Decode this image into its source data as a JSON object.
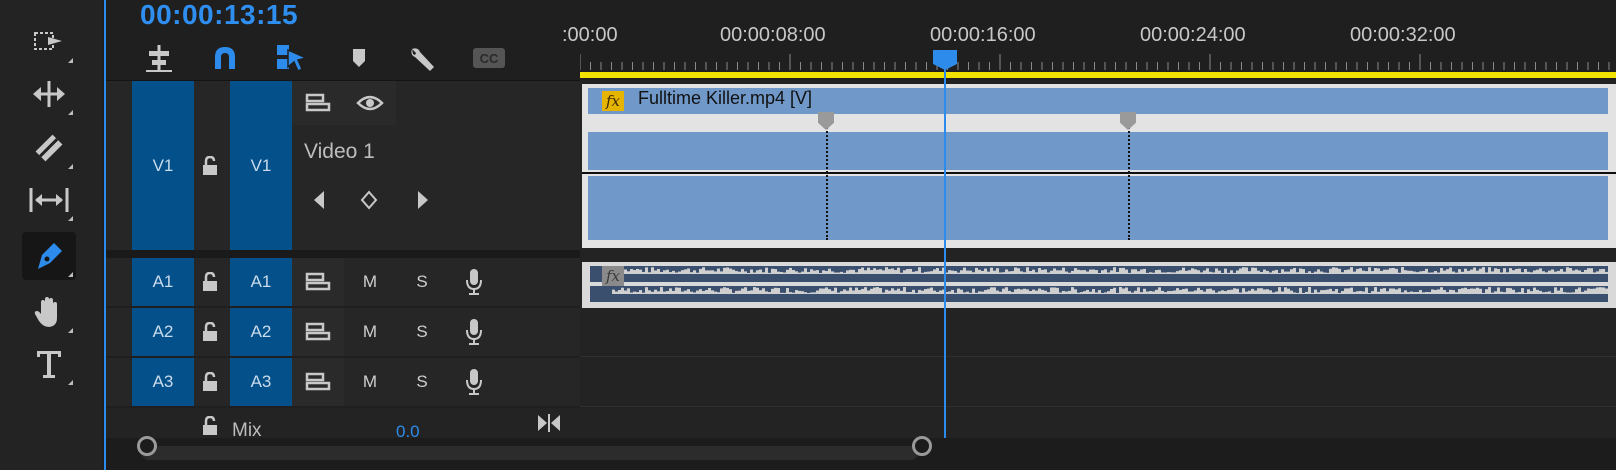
{
  "timeline": {
    "current_timecode": "00:00:13:15",
    "ruler_labels": [
      ":00:00",
      "00:00:08:00",
      "00:00:16:00",
      "00:00:24:00",
      "00:00:32:00"
    ]
  },
  "tools": [
    {
      "name": "track-select-forward-tool",
      "icon": "track-select-icon"
    },
    {
      "name": "ripple-edit-tool",
      "icon": "ripple-edit-icon"
    },
    {
      "name": "razor-tool",
      "icon": "razor-icon"
    },
    {
      "name": "slip-tool",
      "icon": "slip-icon"
    },
    {
      "name": "pen-tool",
      "icon": "pen-icon",
      "active": true
    },
    {
      "name": "hand-tool",
      "icon": "hand-icon"
    },
    {
      "name": "type-tool",
      "icon": "type-icon"
    }
  ],
  "header_buttons": [
    {
      "name": "insert-sequence-nest-button",
      "icon": "nest-icon"
    },
    {
      "name": "snap-button",
      "icon": "magnet-icon",
      "active": true
    },
    {
      "name": "linked-selection-button",
      "icon": "linked-selection-icon",
      "active": true
    },
    {
      "name": "add-marker-button",
      "icon": "marker-icon"
    },
    {
      "name": "timeline-settings-button",
      "icon": "wrench-icon"
    },
    {
      "name": "captions-button",
      "icon": "cc-icon"
    }
  ],
  "tracks": {
    "video": [
      {
        "source": "V1",
        "target": "V1",
        "name": "Video 1"
      }
    ],
    "audio": [
      {
        "source": "A1",
        "target": "A1",
        "mute": "M",
        "solo": "S"
      },
      {
        "source": "A2",
        "target": "A2",
        "mute": "M",
        "solo": "S"
      },
      {
        "source": "A3",
        "target": "A3",
        "mute": "M",
        "solo": "S"
      }
    ],
    "mix": {
      "label": "Mix",
      "value": "0.0"
    }
  },
  "clips": {
    "video_clip_name": "Fulltime Killer.mp4 [V]",
    "fx_label": "fx"
  },
  "colors": {
    "accent": "#2d8ceb",
    "track_target": "#03508a",
    "video_clip": "#7098c9",
    "work_area_bar": "#f2e200",
    "fx_badge": "#e5b400"
  }
}
